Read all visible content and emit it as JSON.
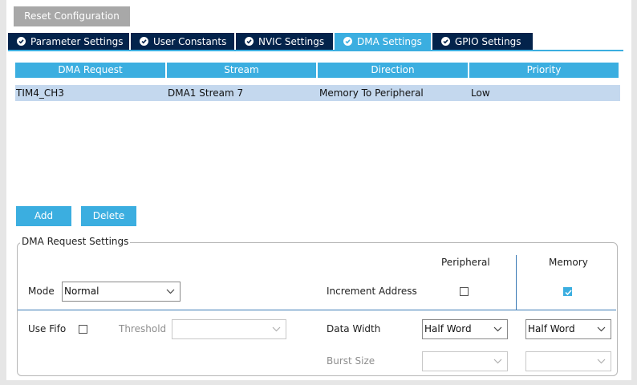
{
  "toolbar": {
    "reset_label": "Reset Configuration"
  },
  "tabs": [
    {
      "label": "Parameter Settings",
      "icon": "check-circle-icon",
      "active": false
    },
    {
      "label": "User Constants",
      "icon": "check-circle-icon",
      "active": false
    },
    {
      "label": "NVIC Settings",
      "icon": "check-circle-icon",
      "active": false
    },
    {
      "label": "DMA Settings",
      "icon": "check-circle-icon",
      "active": true
    },
    {
      "label": "GPIO Settings",
      "icon": "check-circle-icon",
      "active": false
    }
  ],
  "table": {
    "columns": [
      "DMA Request",
      "Stream",
      "Direction",
      "Priority"
    ],
    "rows": [
      [
        "TIM4_CH3",
        "DMA1 Stream 7",
        "Memory To Peripheral",
        "Low"
      ]
    ]
  },
  "actions": {
    "add_label": "Add",
    "delete_label": "Delete"
  },
  "settings": {
    "legend": "DMA Request Settings",
    "peripheral_header": "Peripheral",
    "memory_header": "Memory",
    "mode_label": "Mode",
    "mode_value": "Normal",
    "increment_label": "Increment Address",
    "increment_peripheral": false,
    "increment_memory": true,
    "use_fifo_label": "Use Fifo",
    "use_fifo": false,
    "threshold_label": "Threshold",
    "threshold_value": "",
    "data_width_label": "Data Width",
    "data_width_peripheral": "Half Word",
    "data_width_memory": "Half Word",
    "burst_size_label": "Burst Size",
    "burst_peripheral": "",
    "burst_memory": ""
  },
  "colors": {
    "accent": "#3baee0",
    "tab_dark": "#03234b",
    "row_selected": "#c4d8ee",
    "button_gray": "#a8a8a8"
  }
}
